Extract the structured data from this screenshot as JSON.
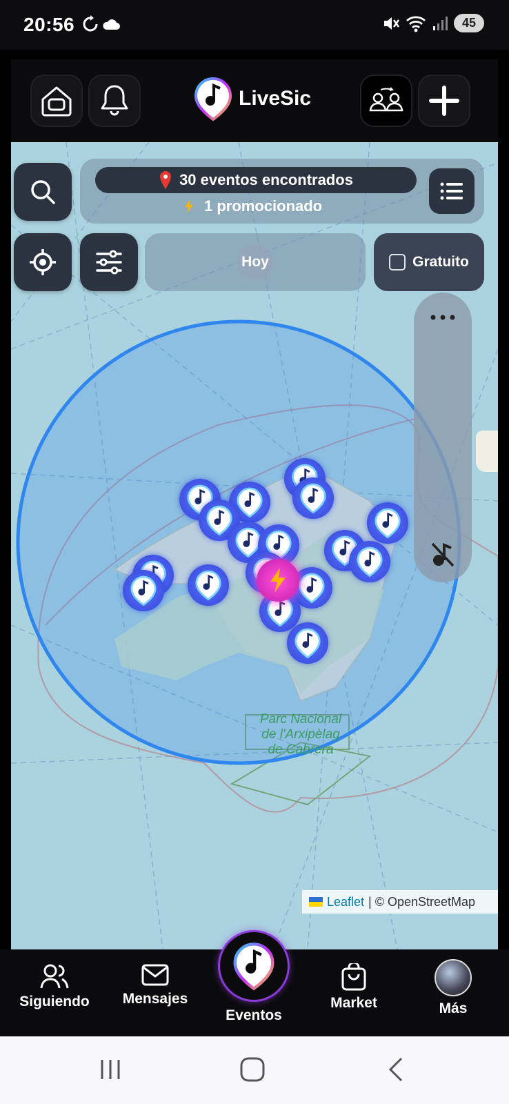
{
  "status": {
    "time": "20:56",
    "battery": "45"
  },
  "app": {
    "name": "LiveSic"
  },
  "summary": {
    "events": "30 eventos encontrados",
    "promoted": "1 promocionado"
  },
  "filters": {
    "date_label": "Hoy",
    "free_label": "Gratuito"
  },
  "map": {
    "labels": [
      "Parc Nacional",
      "de l'Arxipèlag",
      "de Cabrera"
    ],
    "attribution_leaflet": "Leaflet",
    "attribution_osm": "| © OpenStreetMap",
    "radius_color": "#2f86ee"
  },
  "nav": {
    "following": "Siguiendo",
    "messages": "Mensajes",
    "events": "Eventos",
    "market": "Market",
    "more": "Más"
  }
}
